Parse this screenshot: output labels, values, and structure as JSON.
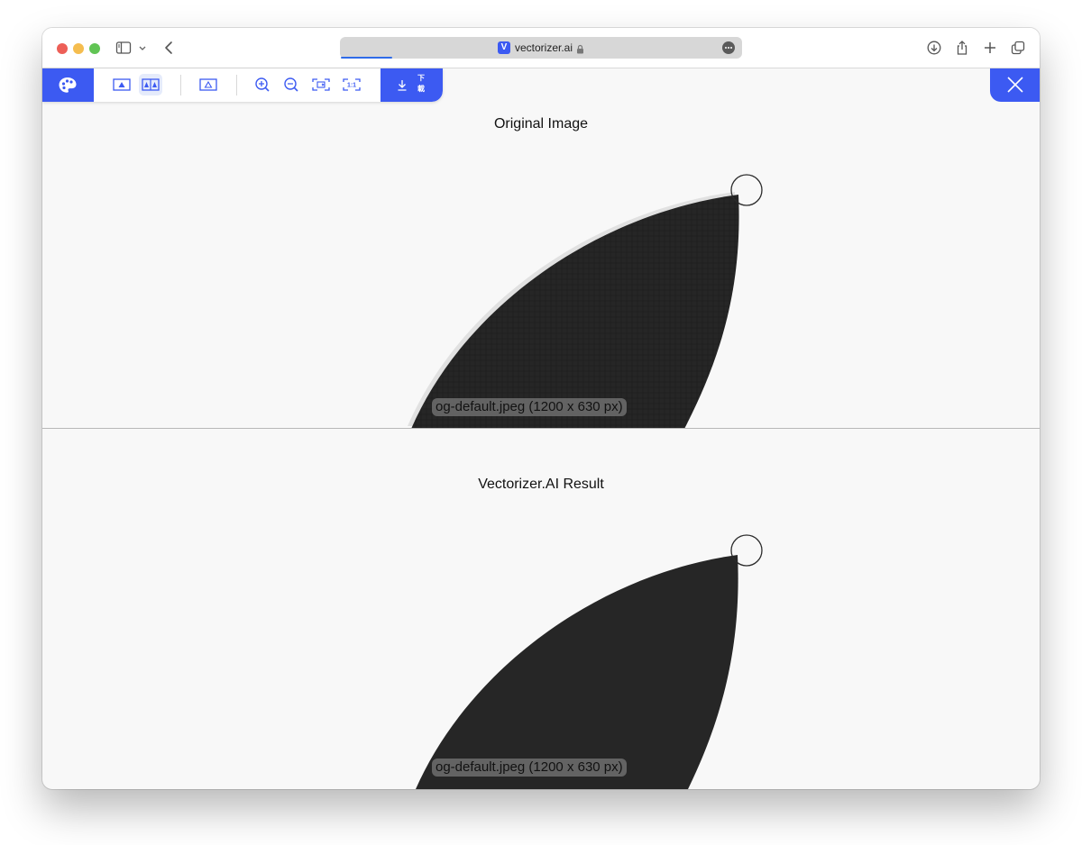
{
  "browser": {
    "url": "vectorizer.ai",
    "favicon_letter": "V",
    "traffic_lights": {
      "close": "#ed5f57",
      "minimize": "#f5bd4f",
      "zoom": "#61c454"
    },
    "icons": [
      "sidebar-icon",
      "chevron-down-icon",
      "back-arrow-icon",
      "lock-icon",
      "page-menu-icon",
      "download-icon",
      "share-icon",
      "plus-icon",
      "tabs-overview-icon"
    ]
  },
  "toolbar": {
    "accent_color": "#3c5af2",
    "tools": [
      "palette-icon",
      "single-view-icon",
      "side-by-side-view-icon",
      "outline-view-icon",
      "zoom-in-icon",
      "zoom-out-icon",
      "fit-to-screen-icon",
      "actual-size-icon"
    ],
    "download_label": "下載",
    "close_icon": "close-icon"
  },
  "panels": {
    "original": {
      "title": "Original Image",
      "file_label": "og-default.jpeg (1200 x 630 px)"
    },
    "result": {
      "title": "Vectorizer.AI Result",
      "file_label": "og-default.jpeg (1200 x 630 px)"
    }
  }
}
